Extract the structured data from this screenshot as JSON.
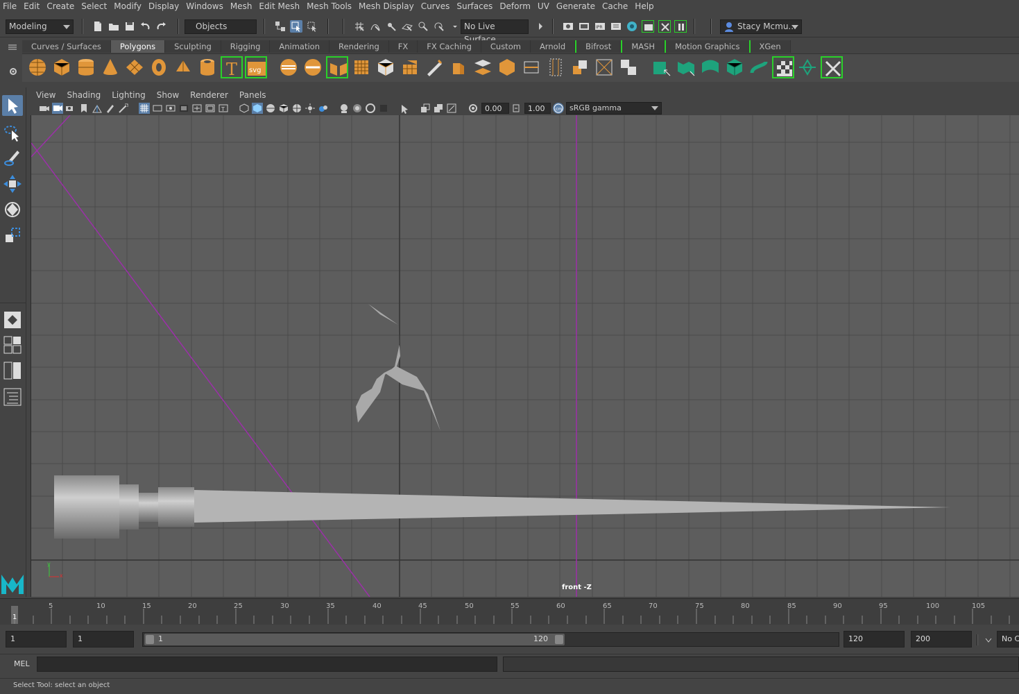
{
  "menu": {
    "items": [
      "File",
      "Edit",
      "Create",
      "Select",
      "Modify",
      "Display",
      "Windows",
      "Mesh",
      "Edit Mesh",
      "Mesh Tools",
      "Mesh Display",
      "Curves",
      "Surfaces",
      "Deform",
      "UV",
      "Generate",
      "Cache",
      "Help"
    ]
  },
  "status_line": {
    "menu_set": "Modeling",
    "selection_mode": "Objects",
    "live_surface": "No Live Surface",
    "user": "Stacy Mcmu..."
  },
  "shelf": {
    "tabs": [
      "Curves / Surfaces",
      "Polygons",
      "Sculpting",
      "Rigging",
      "Animation",
      "Rendering",
      "FX",
      "FX Caching",
      "Custom",
      "Arnold",
      "Bifrost",
      "MASH",
      "Motion Graphics",
      "XGen"
    ],
    "active_tab": "Polygons"
  },
  "panel": {
    "menu": [
      "View",
      "Shading",
      "Lighting",
      "Show",
      "Renderer",
      "Panels"
    ],
    "exposure": "0.00",
    "gamma": "1.00",
    "color_space": "sRGB gamma",
    "camera_label": "front -Z",
    "axis_y": "y",
    "axis_x": "x"
  },
  "timeline": {
    "tick_labels": [
      "5",
      "10",
      "15",
      "20",
      "25",
      "30",
      "35",
      "40",
      "45",
      "50",
      "55",
      "60",
      "65",
      "70",
      "75",
      "80",
      "85",
      "90",
      "95",
      "100",
      "105"
    ],
    "current_frame": "1"
  },
  "range": {
    "start_field": "1",
    "anim_start_field": "1",
    "slider_start": "1",
    "slider_end": "120",
    "end_field": "120",
    "anim_end_field": "200",
    "char_set": "No C"
  },
  "command_line": {
    "label": "MEL",
    "help_text": "Select Tool: select an object"
  },
  "colors": {
    "accent_active": "#5b7fa8",
    "shelf_icon": "#e0963a",
    "viewport_bg": "#5d5d5d",
    "axis_line": "#9b30a8",
    "bracket_green": "#2ad12a"
  }
}
